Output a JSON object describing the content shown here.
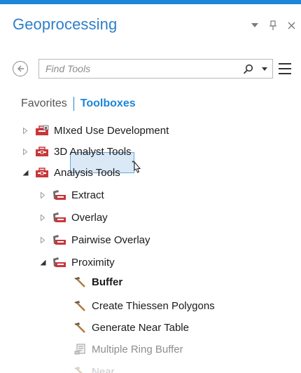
{
  "pane": {
    "title": "Geoprocessing",
    "controls": [
      "chevron-down-icon",
      "pin-icon",
      "close-icon"
    ]
  },
  "search": {
    "placeholder": "Find Tools"
  },
  "tabs": {
    "favorites": "Favorites",
    "toolboxes": "Toolboxes"
  },
  "tree": {
    "items": [
      {
        "label": "MIxed Use Development",
        "icon": "custom-toolbox-icon",
        "level": 0,
        "state": "collapsed"
      },
      {
        "label": "3D Analyst Tools",
        "icon": "toolbox-icon",
        "level": 0,
        "state": "collapsed"
      },
      {
        "label": "Analysis Tools",
        "icon": "toolbox-icon",
        "level": 0,
        "state": "expanded"
      },
      {
        "label": "Extract",
        "icon": "toolset-icon",
        "level": 1,
        "state": "collapsed"
      },
      {
        "label": "Overlay",
        "icon": "toolset-icon",
        "level": 1,
        "state": "collapsed"
      },
      {
        "label": "Pairwise Overlay",
        "icon": "toolset-icon",
        "level": 1,
        "state": "collapsed"
      },
      {
        "label": "Proximity",
        "icon": "toolset-icon",
        "level": 1,
        "state": "expanded"
      },
      {
        "label": "Buffer",
        "icon": "hammer-icon",
        "level": 2,
        "state": "selected"
      },
      {
        "label": "Create Thiessen Polygons",
        "icon": "hammer-icon",
        "level": 2,
        "state": "normal"
      },
      {
        "label": "Generate Near Table",
        "icon": "hammer-icon",
        "level": 2,
        "state": "normal"
      },
      {
        "label": "Multiple Ring Buffer",
        "icon": "script-icon",
        "level": 2,
        "state": "dim"
      },
      {
        "label": "Near",
        "icon": "hammer-icon",
        "level": 2,
        "state": "faded"
      }
    ]
  },
  "colors": {
    "accent": "#1d86d8",
    "title": "#2f7fc9",
    "selection": "#dbe9f7",
    "toolbox_red": "#c8373a"
  }
}
